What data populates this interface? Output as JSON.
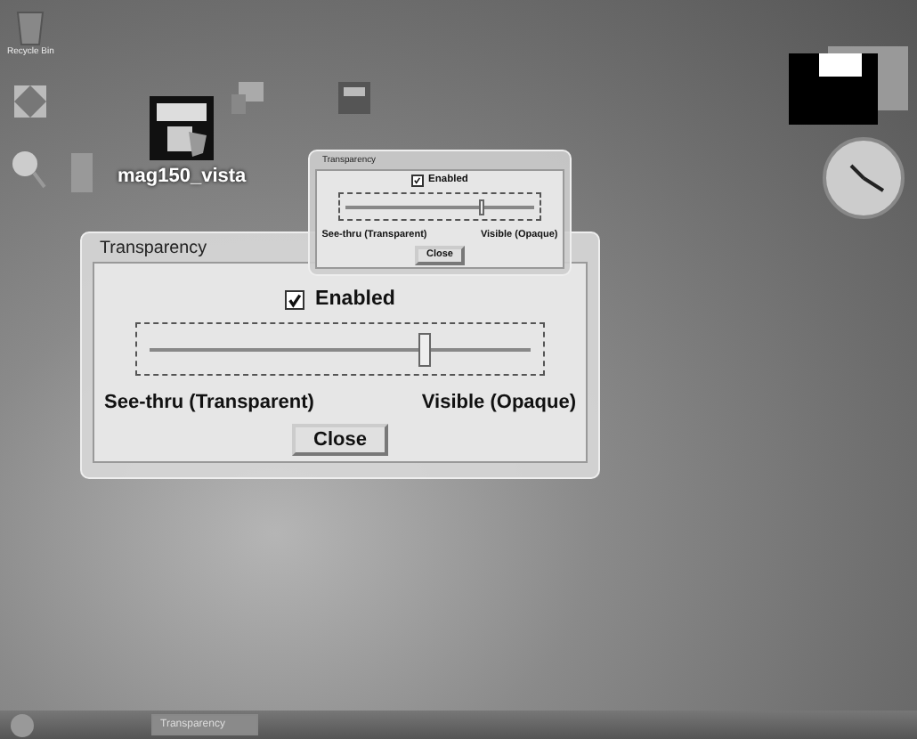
{
  "desktop_icons": [
    {
      "label": "Recycle Bin",
      "kind": "bin"
    },
    {
      "label": "mag150_vista",
      "kind": "app"
    }
  ],
  "background_window": {
    "title": "Transparency",
    "checkbox": {
      "label": "Enabled",
      "checked": true
    },
    "slider": {
      "level": 0.72
    },
    "left_label": "See-thru (Transparent)",
    "right_label": "Visible (Opaque)",
    "button": "Close"
  },
  "dialog": {
    "title": "Transparency",
    "checkbox": {
      "label": "Enabled",
      "checked": true
    },
    "slider": {
      "level": 0.72
    },
    "left_label": "See-thru (Transparent)",
    "right_label": "Visible (Opaque)",
    "button": "Close"
  },
  "taskbar": {
    "buttons": [
      {
        "label": "Transparency",
        "selected": true
      }
    ]
  }
}
